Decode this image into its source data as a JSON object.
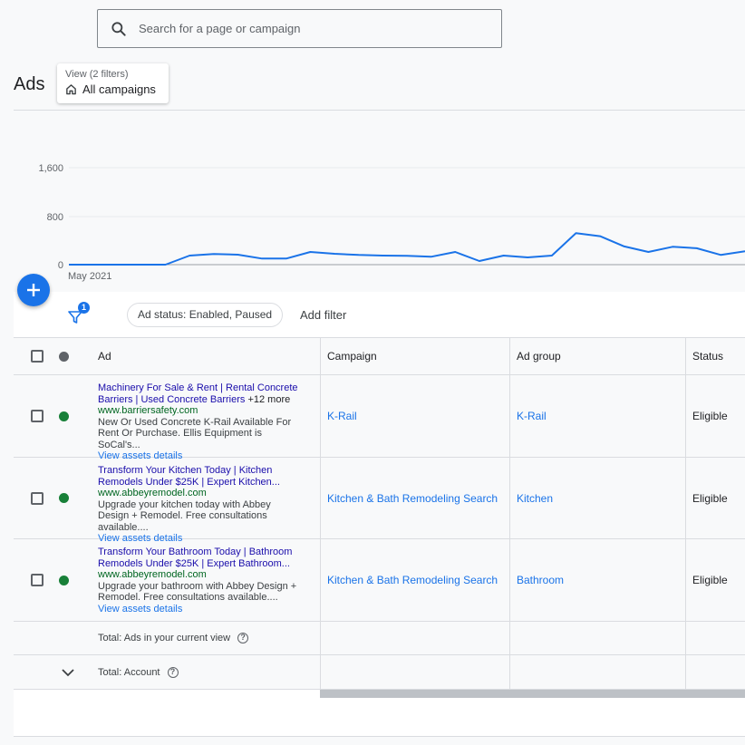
{
  "search": {
    "placeholder": "Search for a page or campaign"
  },
  "page_title": "Ads",
  "view": {
    "label": "View (2 filters)",
    "value": "All campaigns"
  },
  "chart_data": {
    "type": "line",
    "yticks": [
      "1,600",
      "800",
      "0"
    ],
    "ylim": [
      0,
      1600
    ],
    "x_label_start": "May 2021",
    "values": [
      0,
      0,
      0,
      0,
      0,
      150,
      175,
      165,
      100,
      100,
      210,
      180,
      160,
      150,
      145,
      130,
      210,
      60,
      150,
      120,
      150,
      520,
      470,
      300,
      210,
      295,
      270,
      160,
      220
    ],
    "color": "#1a73e8"
  },
  "filters": {
    "badge": "1",
    "chip": "Ad status: Enabled, Paused",
    "add_label": "Add filter"
  },
  "table": {
    "headers": {
      "ad": "Ad",
      "campaign": "Campaign",
      "ad_group": "Ad group",
      "status": "Status"
    },
    "rows": [
      {
        "headline": "Machinery For Sale & Rent | Rental Concrete Barriers | Used Concrete Barriers",
        "more": "+12 more",
        "url": "www.barriersafety.com",
        "desc": "New Or Used Concrete K-Rail Available For Rent Or Purchase. Ellis Equipment is SoCal's...",
        "assets": "View assets details",
        "campaign": "K-Rail",
        "ad_group": "K-Rail",
        "status": "Eligible"
      },
      {
        "headline": "Transform Your Kitchen Today | Kitchen Remodels Under $25K | Expert Kitchen...",
        "more": "",
        "url": "www.abbeyremodel.com",
        "desc": "Upgrade your kitchen today with Abbey Design + Remodel. Free consultations available....",
        "assets": "View assets details",
        "campaign": "Kitchen & Bath Remodeling Search",
        "ad_group": "Kitchen",
        "status": "Eligible"
      },
      {
        "headline": "Transform Your Bathroom Today | Bathroom Remodels Under $25K | Expert Bathroom...",
        "more": "",
        "url": "www.abbeyremodel.com",
        "desc": "Upgrade your bathroom with Abbey Design + Remodel. Free consultations available....",
        "assets": "View assets details",
        "campaign": "Kitchen & Bath Remodeling Search",
        "ad_group": "Bathroom",
        "status": "Eligible"
      }
    ],
    "total_view": "Total: Ads in your current view",
    "total_account": "Total: Account"
  },
  "colors": {
    "accent": "#1a73e8",
    "status_dot_header": "#5f6368",
    "status_dot_enabled": "#188038",
    "headline": "#1a0dab",
    "url": "#006621"
  },
  "icons": {
    "search": "search-icon",
    "fab": "plus-icon",
    "filter": "filter-icon",
    "view": "home-icon",
    "expand": "chevron-down-icon",
    "help": "help-icon"
  }
}
